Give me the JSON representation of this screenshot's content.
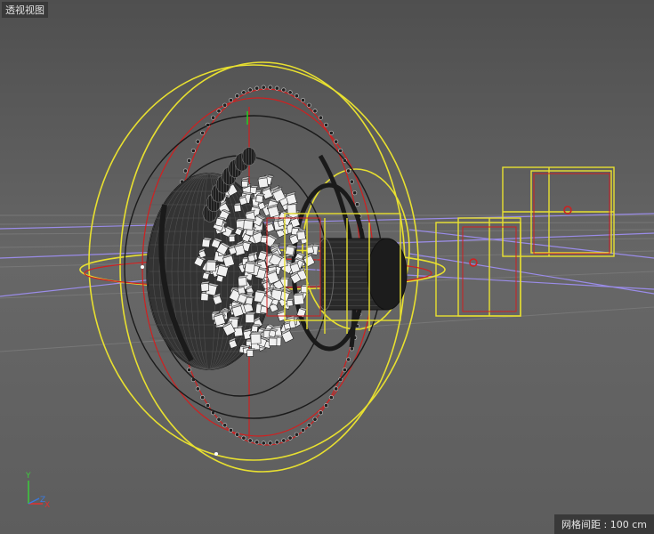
{
  "viewport": {
    "label": "透视视图"
  },
  "hud": {
    "grid_spacing": "网格间距 : 100 cm"
  },
  "axis_gizmo": {
    "y": "Y",
    "x": "X",
    "z": "Z"
  }
}
